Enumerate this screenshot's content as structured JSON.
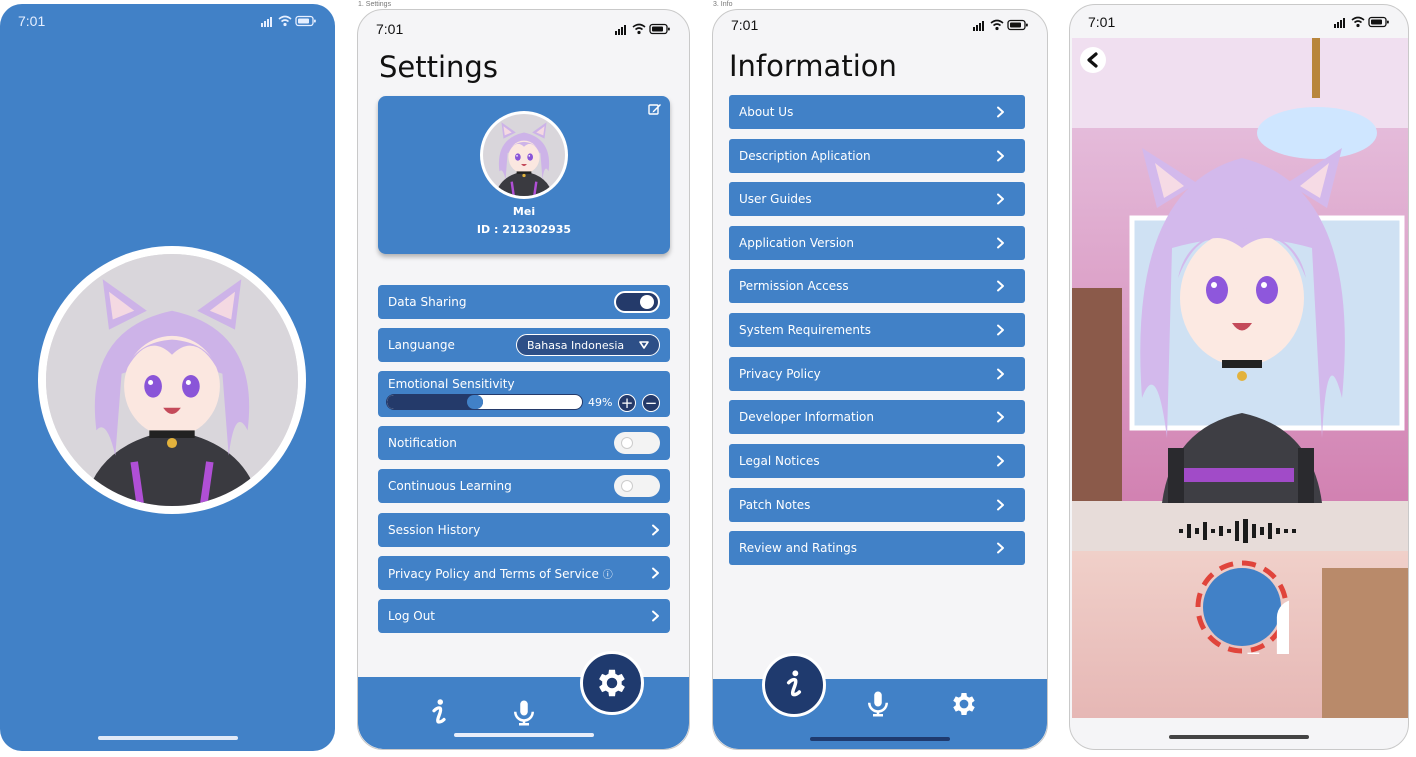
{
  "captions": {
    "splash": "",
    "settings": "1. Settings",
    "info": "3. Info",
    "talking": ""
  },
  "status_time": "7:01",
  "settings": {
    "title": "Settings",
    "profile": {
      "name": "Mei",
      "id": "ID : 212302935"
    },
    "data_sharing": {
      "label": "Data Sharing",
      "on": true
    },
    "language": {
      "label": "Languange",
      "value": "Bahasa Indonesia"
    },
    "emotional_sensitivity": {
      "label": "Emotional Sensitivity",
      "percent_label": "49%",
      "value": 0.49
    },
    "notification": {
      "label": "Notification",
      "on": false
    },
    "continuous_learning": {
      "label": "Continuous Learning",
      "on": false
    },
    "session_history": "Session History",
    "privacy_terms": "Privacy Policy and Terms of Service",
    "info_glyph": "ⓘ",
    "log_out": "Log Out"
  },
  "info": {
    "title": "Information",
    "items": [
      "About Us",
      "Description Aplication",
      "User Guides",
      "Application Version",
      "Permission Access",
      "System Requirements",
      "Privacy Policy",
      "Developer Information",
      "Legal Notices",
      "Patch Notes",
      "Review and Ratings"
    ]
  },
  "colors": {
    "primary": "#4181c7",
    "dark_navy": "#1f3a6e",
    "record_ring": "#e0443b",
    "background": "#f5f5f7"
  },
  "icons": [
    "signal-icon",
    "wifi-icon",
    "battery-icon",
    "edit-icon",
    "chevron-right-icon",
    "caret-down-icon",
    "plus-icon",
    "minus-icon",
    "info-icon",
    "microphone-icon",
    "gear-icon",
    "back-icon",
    "waveform-icon"
  ]
}
